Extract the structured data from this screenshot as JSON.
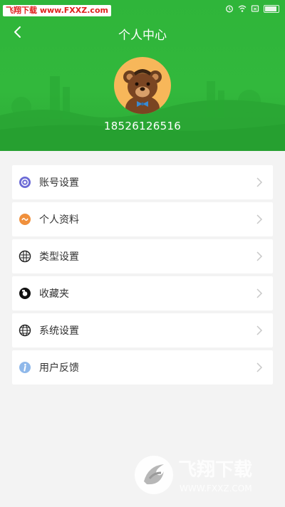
{
  "watermark_top": "飞翔下载 www.FXXZ.com",
  "header": {
    "title": "个人中心",
    "phone": "18526126516"
  },
  "menu": [
    {
      "label": "账号设置",
      "icon": "account-settings-icon",
      "color": "#6b6ad6"
    },
    {
      "label": "个人资料",
      "icon": "profile-icon",
      "color": "#f0903c"
    },
    {
      "label": "类型设置",
      "icon": "type-settings-icon",
      "color": "#222222"
    },
    {
      "label": "收藏夹",
      "icon": "favorites-icon",
      "color": "#111111"
    },
    {
      "label": "系统设置",
      "icon": "globe-icon",
      "color": "#222222"
    },
    {
      "label": "用户反馈",
      "icon": "info-icon",
      "color": "#8fb8ea"
    }
  ],
  "watermark_bottom": {
    "title": "飞翔下载",
    "url": "WWW.FXXZ.COM"
  },
  "colors": {
    "header_green": "#32b83c",
    "background": "#f3f3f3"
  }
}
